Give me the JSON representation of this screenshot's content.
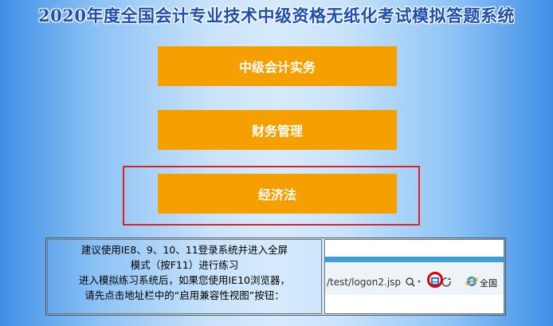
{
  "page": {
    "title": "2020年度全国会计专业技术中级资格无纸化考试模拟答题系统"
  },
  "exam_buttons": [
    {
      "label": "中级会计实务"
    },
    {
      "label": "财务管理"
    },
    {
      "label": "经济法"
    }
  ],
  "notice": {
    "line1": "建议使用IE8、9、10、11登录系统并进入全屏",
    "line2": "模式（按F11）进行练习",
    "line3": "进入模拟练习系统后，如果您使用IE10浏览器，",
    "line4": "请先点击地址栏中的“启用兼容性视图”按钮："
  },
  "browser_example": {
    "url": "/test/logon2.jsp",
    "tab_label": "全国",
    "icons": [
      "search-icon",
      "dropdown-arrow-icon",
      "compatibility-view-icon",
      "refresh-icon",
      "ie-logo-icon"
    ],
    "highlight_color": "#e00000"
  },
  "colors": {
    "button_bg": "#f6a000",
    "title_color": "#1c4fb0",
    "highlight_border": "#e02020"
  }
}
